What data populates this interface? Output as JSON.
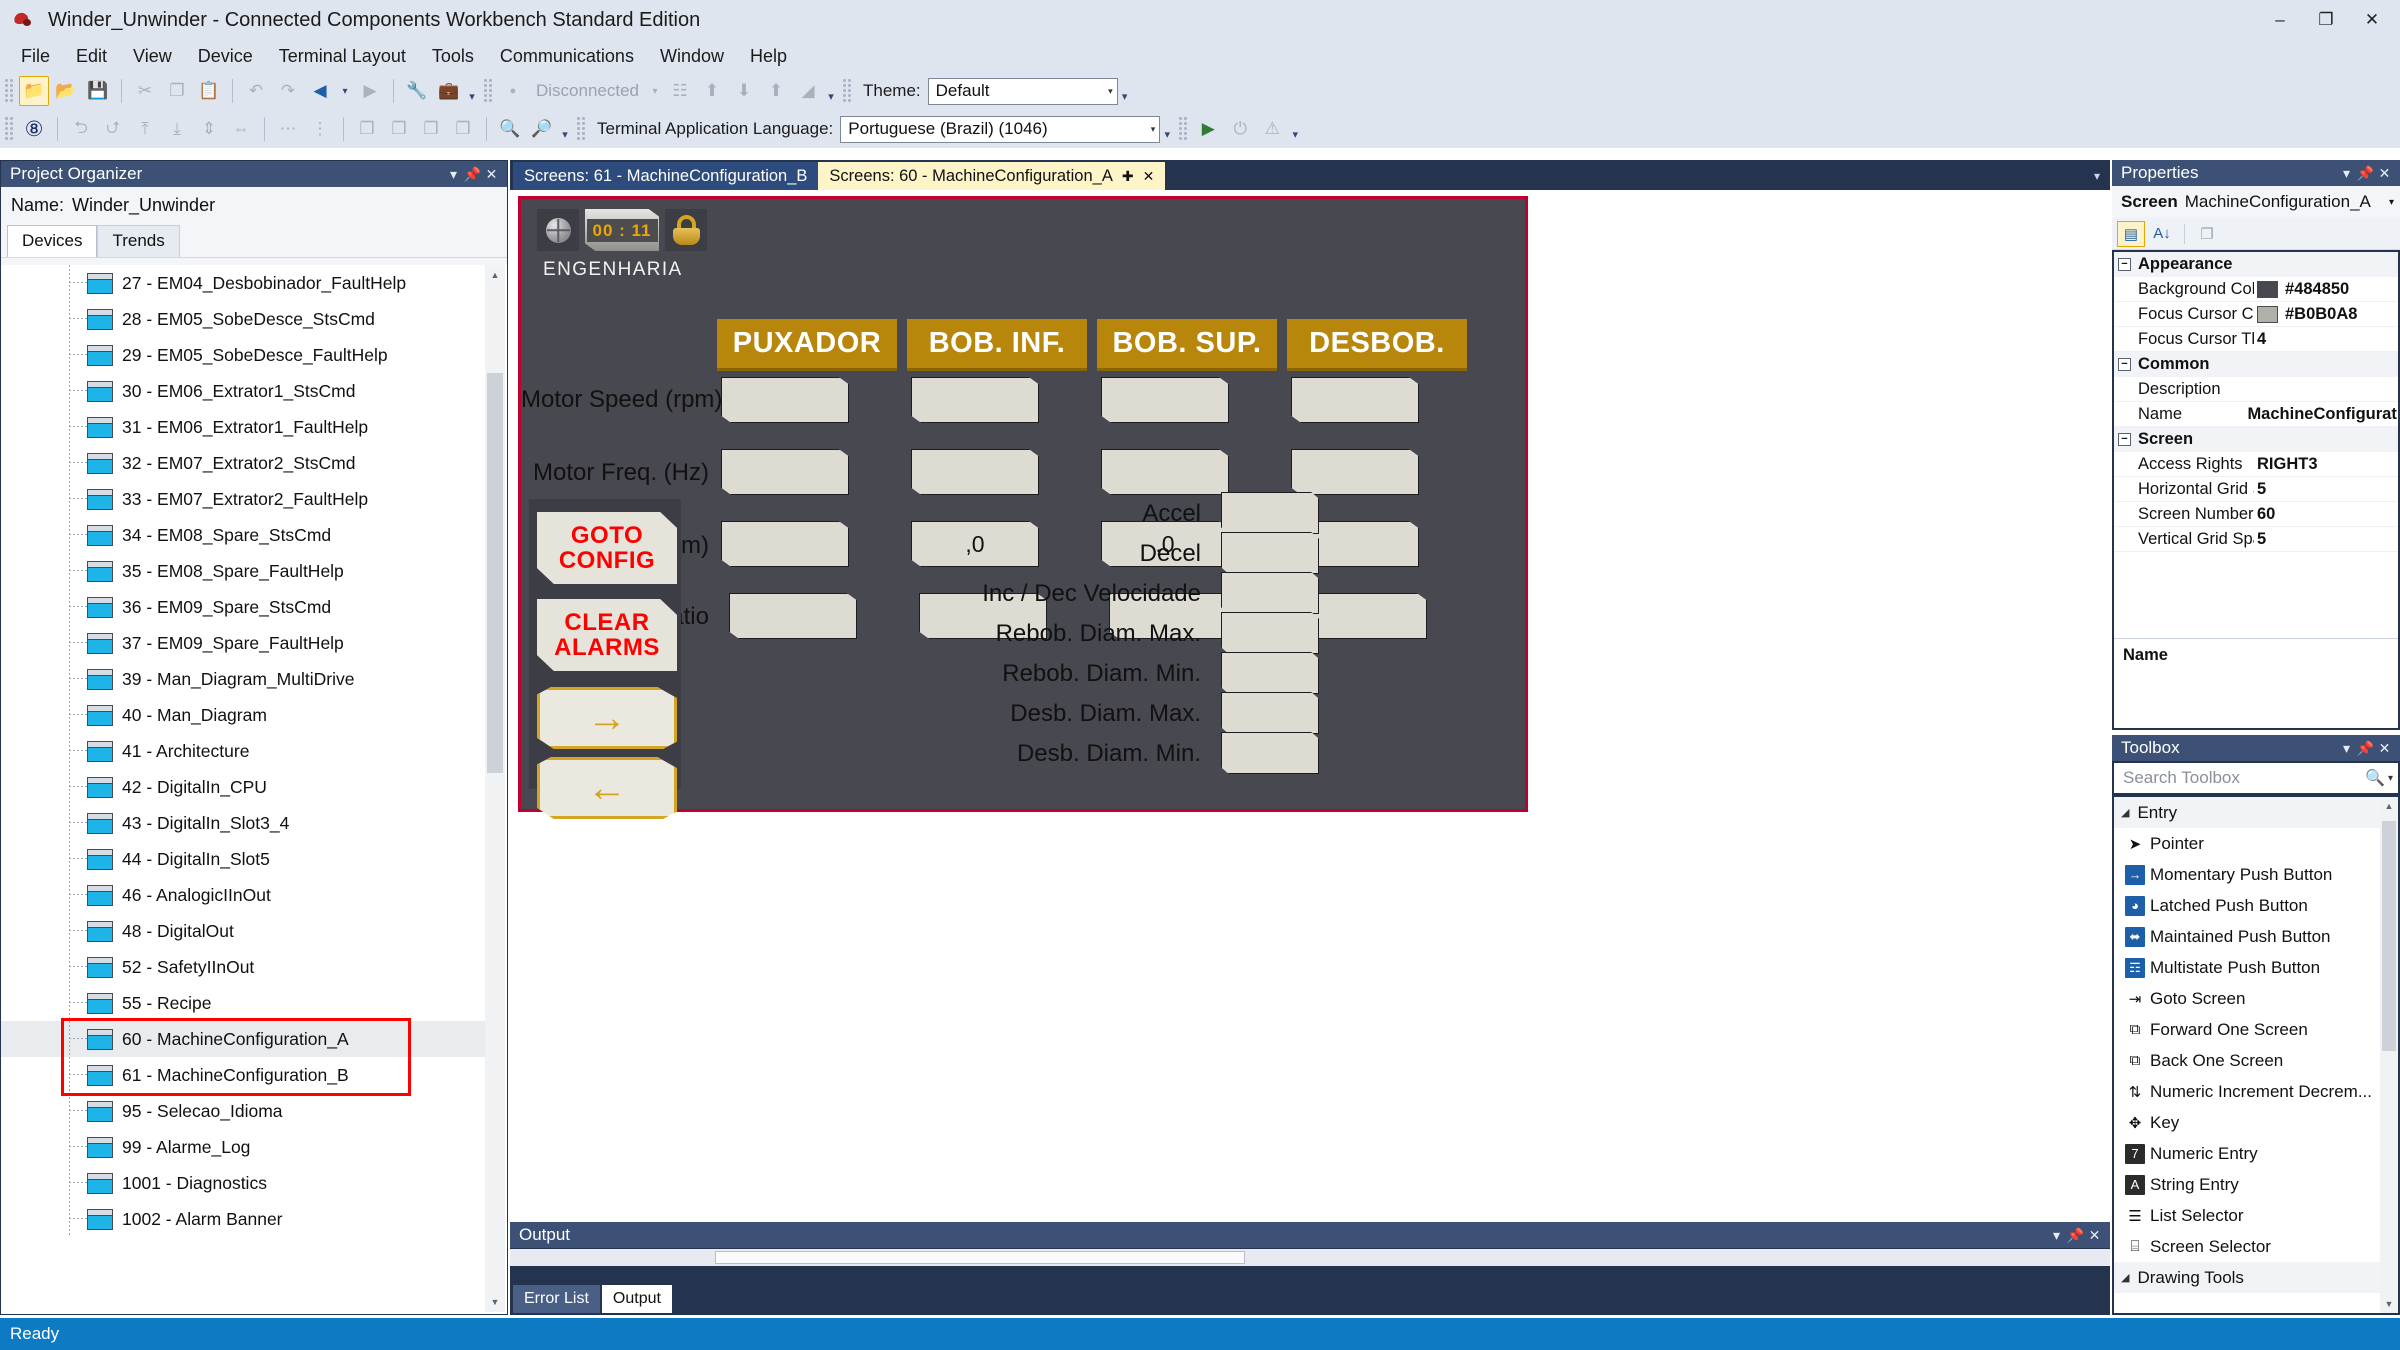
{
  "window": {
    "title": "Winder_Unwinder - Connected Components Workbench Standard Edition",
    "app_icon": "comet-icon",
    "minimize": "–",
    "maximize": "❐",
    "close": "✕"
  },
  "menubar": {
    "items": [
      "File",
      "Edit",
      "View",
      "Device",
      "Terminal Layout",
      "Tools",
      "Communications",
      "Window",
      "Help"
    ]
  },
  "toolbar1": {
    "buttons": [
      {
        "name": "new-project-icon",
        "glyph": "🗀",
        "state": "selected"
      },
      {
        "name": "open-project-icon",
        "glyph": "📂",
        "state": "normal"
      },
      {
        "name": "save-icon",
        "glyph": "💾",
        "state": "normal"
      },
      {
        "name": "cut-icon",
        "glyph": "✂",
        "state": "disabled"
      },
      {
        "name": "copy-icon",
        "glyph": "❐",
        "state": "disabled"
      },
      {
        "name": "paste-icon",
        "glyph": "📋",
        "state": "disabled"
      },
      {
        "name": "undo-icon",
        "glyph": "↶",
        "state": "disabled"
      },
      {
        "name": "redo-icon",
        "glyph": "↷",
        "state": "disabled"
      },
      {
        "name": "navigate-back-icon",
        "glyph": "◀",
        "state": "normal"
      },
      {
        "name": "navigate-back-dropdown-icon",
        "glyph": "▾",
        "state": "normal"
      },
      {
        "name": "navigate-forward-icon",
        "glyph": "▶",
        "state": "disabled"
      },
      {
        "name": "settings-wrench-icon",
        "glyph": "🔧",
        "state": "normal"
      },
      {
        "name": "toolbox-case-icon",
        "glyph": "🧰",
        "state": "normal"
      }
    ],
    "connection_icon": "connection-status-icon",
    "connection_label": "Disconnected",
    "connection_caret": "▾",
    "device_buttons": [
      {
        "name": "verify-device-icon",
        "glyph": "☷"
      },
      {
        "name": "build-icon",
        "glyph": "⬆"
      },
      {
        "name": "download-icon",
        "glyph": "⬇"
      },
      {
        "name": "upload-icon",
        "glyph": "⬆"
      },
      {
        "name": "diagnose-icon",
        "glyph": "◢"
      }
    ],
    "theme_label": "Theme:",
    "theme_value": "Default",
    "caret": "▾"
  },
  "toolbar2": {
    "grid_icon": {
      "name": "show-grid-icon",
      "glyph": "⌗"
    },
    "align_buttons": [
      {
        "name": "align-left-icon",
        "glyph": "⮌"
      },
      {
        "name": "align-right-icon",
        "glyph": "⮍"
      },
      {
        "name": "align-top-icon",
        "glyph": "⤒"
      },
      {
        "name": "align-bottom-icon",
        "glyph": "⤓"
      },
      {
        "name": "align-center-horizontal-icon",
        "glyph": "⇕"
      },
      {
        "name": "align-center-vertical-icon",
        "glyph": "⇔"
      },
      {
        "name": "distribute-horizontal-icon",
        "glyph": "⋮"
      },
      {
        "name": "distribute-vertical-icon",
        "glyph": "⋯"
      },
      {
        "name": "bring-to-front-icon",
        "glyph": "❐"
      },
      {
        "name": "send-to-back-icon",
        "glyph": "❐"
      },
      {
        "name": "bring-forward-icon",
        "glyph": "❐"
      },
      {
        "name": "send-backward-icon",
        "glyph": "❐"
      }
    ],
    "zoom_in_icon": {
      "name": "zoom-in-icon",
      "glyph": "🔍"
    },
    "zoom_out_icon": {
      "name": "zoom-out-icon",
      "glyph": "🔎"
    },
    "language_label": "Terminal Application Language:",
    "language_value": "Portuguese (Brazil) (1046)",
    "trailing_buttons": [
      {
        "name": "run-terminal-icon",
        "glyph": "▶"
      },
      {
        "name": "power-icon",
        "glyph": "⏻"
      },
      {
        "name": "warning-icon",
        "glyph": "⚠"
      }
    ]
  },
  "project_organizer": {
    "title": "Project Organizer",
    "panel_buttons": [
      "▾",
      "📌",
      "✕"
    ],
    "name_label": "Name:",
    "name_value": "Winder_Unwinder",
    "tabs": [
      {
        "label": "Devices",
        "active": true
      },
      {
        "label": "Trends",
        "active": false
      }
    ],
    "toolbar_icons": [
      {
        "name": "add-device-icon",
        "glyph": "⊞"
      },
      {
        "name": "remove-device-icon",
        "glyph": "⊟"
      },
      {
        "name": "device-tree-icon",
        "glyph": "⎇"
      }
    ],
    "tree_items": [
      {
        "label": "27 - EM04_Desbobinador_FaultHelp",
        "selected": false
      },
      {
        "label": "28 - EM05_SobeDesce_StsCmd",
        "selected": false
      },
      {
        "label": "29 - EM05_SobeDesce_FaultHelp",
        "selected": false
      },
      {
        "label": "30 - EM06_Extrator1_StsCmd",
        "selected": false
      },
      {
        "label": "31 - EM06_Extrator1_FaultHelp",
        "selected": false
      },
      {
        "label": "32 - EM07_Extrator2_StsCmd",
        "selected": false
      },
      {
        "label": "33 - EM07_Extrator2_FaultHelp",
        "selected": false
      },
      {
        "label": "34 - EM08_Spare_StsCmd",
        "selected": false
      },
      {
        "label": "35 - EM08_Spare_FaultHelp",
        "selected": false
      },
      {
        "label": "36 - EM09_Spare_StsCmd",
        "selected": false
      },
      {
        "label": "37 - EM09_Spare_FaultHelp",
        "selected": false
      },
      {
        "label": "39 - Man_Diagram_MultiDrive",
        "selected": false
      },
      {
        "label": "40 - Man_Diagram",
        "selected": false
      },
      {
        "label": "41 - Architecture",
        "selected": false
      },
      {
        "label": "42 - DigitalIn_CPU",
        "selected": false
      },
      {
        "label": "43 - DigitalIn_Slot3_4",
        "selected": false
      },
      {
        "label": "44 - DigitalIn_Slot5",
        "selected": false
      },
      {
        "label": "46 - AnalogicIInOut",
        "selected": false
      },
      {
        "label": "48 - DigitalOut",
        "selected": false
      },
      {
        "label": "52 - SafetyIInOut",
        "selected": false
      },
      {
        "label": "55 - Recipe",
        "selected": false
      },
      {
        "label": "60 - MachineConfiguration_A",
        "selected": true
      },
      {
        "label": "61 - MachineConfiguration_B",
        "selected": false
      },
      {
        "label": "95 - Selecao_Idioma",
        "selected": false
      },
      {
        "label": "99 - Alarme_Log",
        "selected": false
      },
      {
        "label": "1001 - Diagnostics",
        "selected": false
      },
      {
        "label": "1002 - Alarm Banner",
        "selected": false
      }
    ],
    "highlight_color": "#ff0000"
  },
  "editor": {
    "tabs": [
      {
        "label": "Screens: 61 - MachineConfiguration_B",
        "active": false,
        "pin": "",
        "close": ""
      },
      {
        "label": "Screens: 60 - MachineConfiguration_A",
        "active": true,
        "pin": "📌",
        "close": "✕"
      }
    ],
    "overflow_caret": "▾"
  },
  "hmi": {
    "background_color": "#484850",
    "border_color": "#c00030",
    "globe_icon": "globe-language-icon",
    "timer_value": "00 : 11",
    "lock_icon": "padlock-icon",
    "user_label": "ENGENHARIA",
    "column_headers": [
      "PUXADOR",
      "BOB. INF.",
      "BOB. SUP.",
      "DESBOB."
    ],
    "header_color": "#b8860b",
    "rows": [
      {
        "label": "Motor Speed (rpm)",
        "values": [
          "",
          "",
          "",
          ""
        ]
      },
      {
        "label": "Motor Freq. (Hz)",
        "values": [
          "",
          "",
          "",
          ""
        ]
      },
      {
        "label": "Diametro (mm)",
        "values": [
          "",
          ",0",
          ",0",
          ""
        ]
      },
      {
        "label": "Gear Ratio",
        "values": [
          "",
          "",
          "",
          ""
        ]
      }
    ],
    "right_params": [
      {
        "label": "Accel",
        "value": ""
      },
      {
        "label": "Decel",
        "value": ""
      },
      {
        "label": "Inc / Dec Velocidade",
        "value": ""
      },
      {
        "label": "Rebob. Diam. Max.",
        "value": ""
      },
      {
        "label": "Rebob. Diam. Min.",
        "value": ""
      },
      {
        "label": "Desb. Diam. Max.",
        "value": ""
      },
      {
        "label": "Desb. Diam. Min.",
        "value": ""
      }
    ],
    "goto_config_line1": "GOTO",
    "goto_config_line2": "CONFIG",
    "clear_alarms_line1": "CLEAR",
    "clear_alarms_line2": "ALARMS",
    "forward_arrow": "→",
    "back_arrow": "←",
    "button_text_color": "#ff0000"
  },
  "output_panel": {
    "title": "Output",
    "panel_buttons": [
      "▾",
      "📌",
      "✕"
    ],
    "tabs": [
      {
        "label": "Error List",
        "active": false
      },
      {
        "label": "Output",
        "active": true
      }
    ]
  },
  "properties": {
    "title": "Properties",
    "panel_buttons": [
      "▾",
      "📌",
      "✕"
    ],
    "selector_type": "Screen",
    "selector_value": "MachineConfiguration_A",
    "selector_caret": "▾",
    "toolbar_icons": [
      {
        "name": "categorized-view-icon",
        "glyph": "☰",
        "selected": true
      },
      {
        "name": "alphabetical-sort-icon",
        "glyph": "↓",
        "selected": false
      },
      {
        "name": "property-pages-icon",
        "glyph": "❐",
        "selected": false
      }
    ],
    "groups": [
      {
        "name": "Appearance",
        "expander": "−",
        "rows": [
          {
            "key": "Background Colc",
            "value": "#484850",
            "swatch": "#484850"
          },
          {
            "key": "Focus Cursor Col",
            "value": "#B0B0A8",
            "swatch": "#B0B0A8"
          },
          {
            "key": "Focus Cursor Thi‹",
            "value": "4",
            "swatch": null
          }
        ]
      },
      {
        "name": "Common",
        "expander": "−",
        "rows": [
          {
            "key": "Description",
            "value": "",
            "swatch": null
          },
          {
            "key": "Name",
            "value": "MachineConfiguratio",
            "swatch": null
          }
        ]
      },
      {
        "name": "Screen",
        "expander": "−",
        "rows": [
          {
            "key": "Access Rights",
            "value": "RIGHT3",
            "swatch": null
          },
          {
            "key": "Horizontal Grid S",
            "value": "5",
            "swatch": null
          },
          {
            "key": "Screen Number",
            "value": "60",
            "swatch": null
          },
          {
            "key": "Vertical Grid Spac",
            "value": "5",
            "swatch": null
          }
        ]
      }
    ],
    "description_title": "Name"
  },
  "toolbox": {
    "title": "Toolbox",
    "panel_buttons": [
      "▾",
      "📌",
      "✕"
    ],
    "search_placeholder": "Search Toolbox",
    "search_icon": "magnifier-icon",
    "search_caret": "▾",
    "categories": [
      {
        "name": "Entry",
        "triangle": "◢",
        "items": [
          {
            "label": "Pointer",
            "icon": "pointer-icon",
            "glyph": "➤",
            "chip": false
          },
          {
            "label": "Momentary Push Button",
            "icon": "momentary-push-button-icon",
            "glyph": "→",
            "chip": true
          },
          {
            "label": "Latched Push Button",
            "icon": "latched-push-button-icon",
            "glyph": "◕",
            "chip": true
          },
          {
            "label": "Maintained Push Button",
            "icon": "maintained-push-button-icon",
            "glyph": "⬌",
            "chip": true
          },
          {
            "label": "Multistate Push Button",
            "icon": "multistate-push-button-icon",
            "glyph": "☶",
            "chip": true
          },
          {
            "label": "Goto Screen",
            "icon": "goto-screen-icon",
            "glyph": "⇥",
            "chip": false
          },
          {
            "label": "Forward One Screen",
            "icon": "forward-one-screen-icon",
            "glyph": "⧉",
            "chip": false
          },
          {
            "label": "Back One Screen",
            "icon": "back-one-screen-icon",
            "glyph": "⧉",
            "chip": false
          },
          {
            "label": "Numeric Increment Decrem...",
            "icon": "numeric-increment-decrement-icon",
            "glyph": "⇅",
            "chip": false
          },
          {
            "label": "Key",
            "icon": "key-icon",
            "glyph": "✥",
            "chip": false
          },
          {
            "label": "Numeric Entry",
            "icon": "numeric-entry-icon",
            "glyph": "7",
            "chip": true
          },
          {
            "label": "String Entry",
            "icon": "string-entry-icon",
            "glyph": "A",
            "chip": true
          },
          {
            "label": "List Selector",
            "icon": "list-selector-icon",
            "glyph": "☰",
            "chip": false
          },
          {
            "label": "Screen Selector",
            "icon": "screen-selector-icon",
            "glyph": "⌸",
            "chip": false
          }
        ]
      },
      {
        "name": "Drawing Tools",
        "triangle": "◢",
        "items": []
      }
    ]
  },
  "statusbar": {
    "text": "Ready",
    "color": "#0d7ac4"
  }
}
